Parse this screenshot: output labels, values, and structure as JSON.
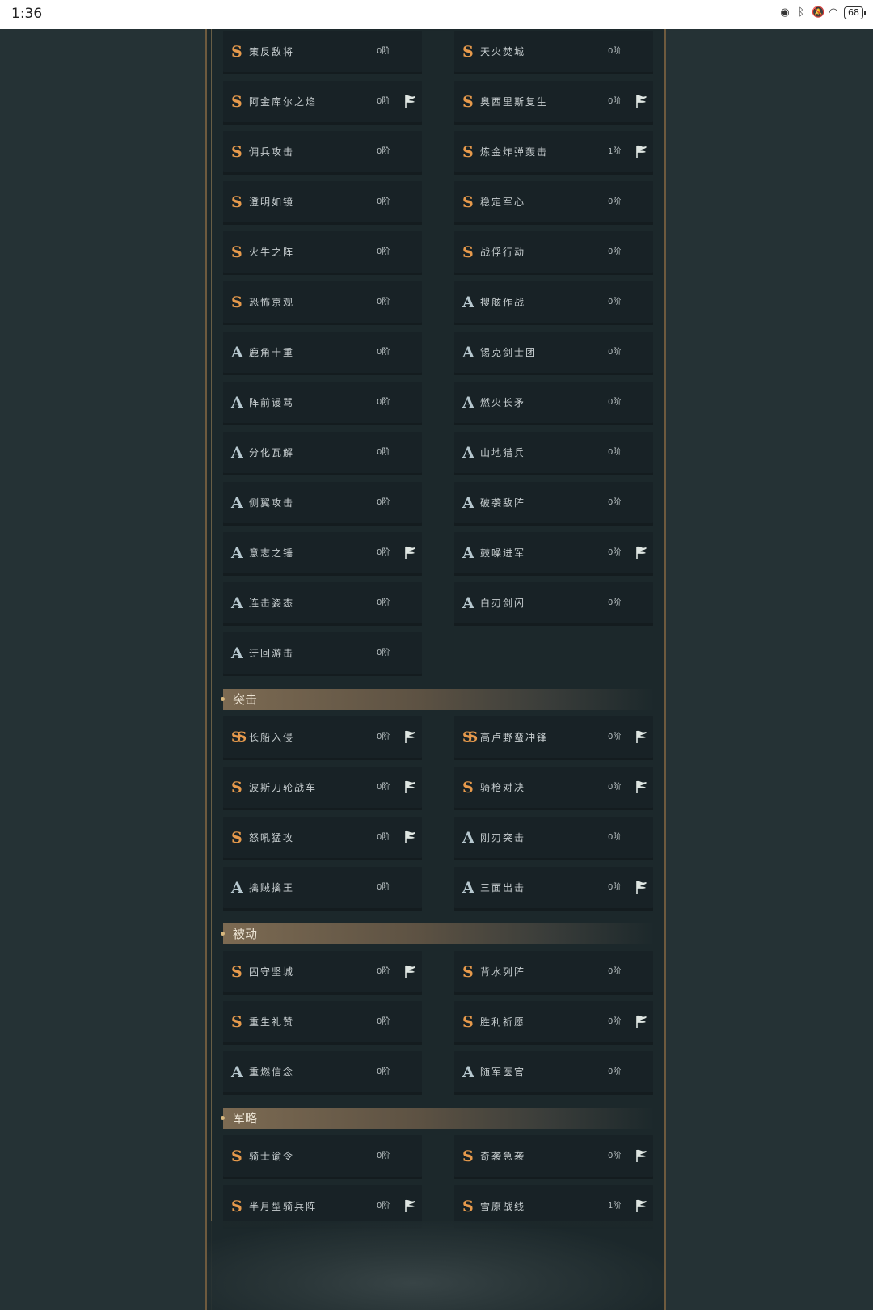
{
  "status": {
    "time": "1:36",
    "battery": "68"
  },
  "flag_icon": "flag-icon",
  "group1": {
    "rows": [
      [
        {
          "grade": "S",
          "name": "策反敌将",
          "level": "0阶",
          "flag": false
        },
        {
          "grade": "S",
          "name": "天火焚城",
          "level": "0阶",
          "flag": false
        }
      ],
      [
        {
          "grade": "S",
          "name": "阿金库尔之焰",
          "level": "0阶",
          "flag": true
        },
        {
          "grade": "S",
          "name": "奥西里斯复生",
          "level": "0阶",
          "flag": true
        }
      ],
      [
        {
          "grade": "S",
          "name": "佣兵攻击",
          "level": "0阶",
          "flag": false
        },
        {
          "grade": "S",
          "name": "炼金炸弹轰击",
          "level": "1阶",
          "flag": true
        }
      ],
      [
        {
          "grade": "S",
          "name": "澄明如镜",
          "level": "0阶",
          "flag": false
        },
        {
          "grade": "S",
          "name": "稳定军心",
          "level": "0阶",
          "flag": false
        }
      ],
      [
        {
          "grade": "S",
          "name": "火牛之阵",
          "level": "0阶",
          "flag": false
        },
        {
          "grade": "S",
          "name": "战俘行动",
          "level": "0阶",
          "flag": false
        }
      ],
      [
        {
          "grade": "S",
          "name": "恐怖京观",
          "level": "0阶",
          "flag": false
        },
        {
          "grade": "A",
          "name": "搜舷作战",
          "level": "0阶",
          "flag": false
        }
      ],
      [
        {
          "grade": "A",
          "name": "鹿角十重",
          "level": "0阶",
          "flag": false
        },
        {
          "grade": "A",
          "name": "锡克剑士团",
          "level": "0阶",
          "flag": false
        }
      ],
      [
        {
          "grade": "A",
          "name": "阵前谩骂",
          "level": "0阶",
          "flag": false
        },
        {
          "grade": "A",
          "name": "燃火长矛",
          "level": "0阶",
          "flag": false
        }
      ],
      [
        {
          "grade": "A",
          "name": "分化瓦解",
          "level": "0阶",
          "flag": false
        },
        {
          "grade": "A",
          "name": "山地猎兵",
          "level": "0阶",
          "flag": false
        }
      ],
      [
        {
          "grade": "A",
          "name": "侧翼攻击",
          "level": "0阶",
          "flag": false
        },
        {
          "grade": "A",
          "name": "破袭敌阵",
          "level": "0阶",
          "flag": false
        }
      ],
      [
        {
          "grade": "A",
          "name": "意志之锤",
          "level": "0阶",
          "flag": true
        },
        {
          "grade": "A",
          "name": "鼓噪进军",
          "level": "0阶",
          "flag": true
        }
      ],
      [
        {
          "grade": "A",
          "name": "连击姿态",
          "level": "0阶",
          "flag": false
        },
        {
          "grade": "A",
          "name": "白刃剑闪",
          "level": "0阶",
          "flag": false
        }
      ],
      [
        {
          "grade": "A",
          "name": "迂回游击",
          "level": "0阶",
          "flag": false
        }
      ]
    ]
  },
  "sections": [
    {
      "title": "突击",
      "rows": [
        [
          {
            "grade": "SS",
            "name": "长船入侵",
            "level": "0阶",
            "flag": true
          },
          {
            "grade": "SS",
            "name": "高卢野蛮冲锋",
            "level": "0阶",
            "flag": true
          }
        ],
        [
          {
            "grade": "S",
            "name": "波斯刀轮战车",
            "level": "0阶",
            "flag": true
          },
          {
            "grade": "S",
            "name": "骑枪对决",
            "level": "0阶",
            "flag": true
          }
        ],
        [
          {
            "grade": "S",
            "name": "怒吼猛攻",
            "level": "0阶",
            "flag": true
          },
          {
            "grade": "A",
            "name": "刚刃突击",
            "level": "0阶",
            "flag": false
          }
        ],
        [
          {
            "grade": "A",
            "name": "擒贼擒王",
            "level": "0阶",
            "flag": false
          },
          {
            "grade": "A",
            "name": "三面出击",
            "level": "0阶",
            "flag": true
          }
        ]
      ]
    },
    {
      "title": "被动",
      "rows": [
        [
          {
            "grade": "S",
            "name": "固守坚城",
            "level": "0阶",
            "flag": true
          },
          {
            "grade": "S",
            "name": "背水列阵",
            "level": "0阶",
            "flag": false
          }
        ],
        [
          {
            "grade": "S",
            "name": "重生礼赞",
            "level": "0阶",
            "flag": false
          },
          {
            "grade": "S",
            "name": "胜利祈愿",
            "level": "0阶",
            "flag": true
          }
        ],
        [
          {
            "grade": "A",
            "name": "重燃信念",
            "level": "0阶",
            "flag": false
          },
          {
            "grade": "A",
            "name": "随军医官",
            "level": "0阶",
            "flag": false
          }
        ]
      ]
    },
    {
      "title": "军略",
      "rows": [
        [
          {
            "grade": "S",
            "name": "骑士谕令",
            "level": "0阶",
            "flag": false
          },
          {
            "grade": "S",
            "name": "奇袭急袭",
            "level": "0阶",
            "flag": true
          }
        ],
        [
          {
            "grade": "S",
            "name": "半月型骑兵阵",
            "level": "0阶",
            "flag": true
          },
          {
            "grade": "S",
            "name": "雪原战线",
            "level": "1阶",
            "flag": true
          }
        ]
      ]
    }
  ],
  "colors": {
    "grade_s": "#e79a4c",
    "grade_a": "#b7c8cf",
    "panel_border": "#6e5a3e"
  }
}
